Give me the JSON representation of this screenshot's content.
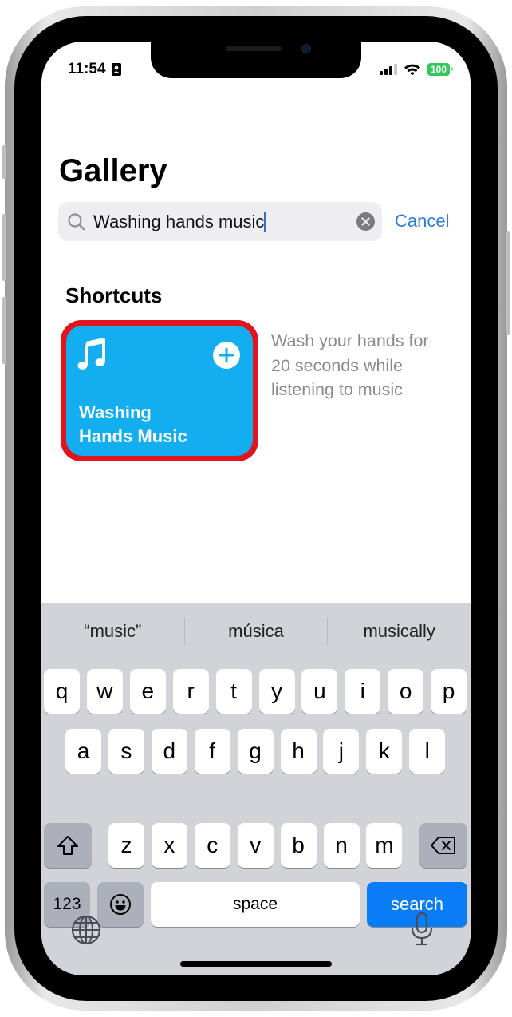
{
  "status_bar": {
    "time": "11:54",
    "battery": "100",
    "icons": [
      "contact-card-icon",
      "cellular-signal-icon",
      "wifi-icon",
      "battery-icon"
    ]
  },
  "page": {
    "title": "Gallery"
  },
  "search": {
    "value": "Washing hands music",
    "icon": "search-icon",
    "clear_icon": "clear-icon",
    "cancel_label": "Cancel"
  },
  "results": {
    "section_title": "Shortcuts",
    "shortcuts": [
      {
        "title": "Washing\nHands Music",
        "description": "Wash your hands for 20 seconds while listening to music",
        "icon": "music-note-icon",
        "add_icon": "plus-circle-icon",
        "color": "#13aef0",
        "highlight_color": "#e0151e"
      }
    ]
  },
  "keyboard": {
    "suggestions": [
      "“music”",
      "música",
      "musically"
    ],
    "rows": [
      [
        "q",
        "w",
        "e",
        "r",
        "t",
        "y",
        "u",
        "i",
        "o",
        "p"
      ],
      [
        "a",
        "s",
        "d",
        "f",
        "g",
        "h",
        "j",
        "k",
        "l"
      ],
      [
        "z",
        "x",
        "c",
        "v",
        "b",
        "n",
        "m"
      ]
    ],
    "numbers_label": "123",
    "space_label": "space",
    "action_label": "search",
    "action_color": "#0a7cf7"
  }
}
